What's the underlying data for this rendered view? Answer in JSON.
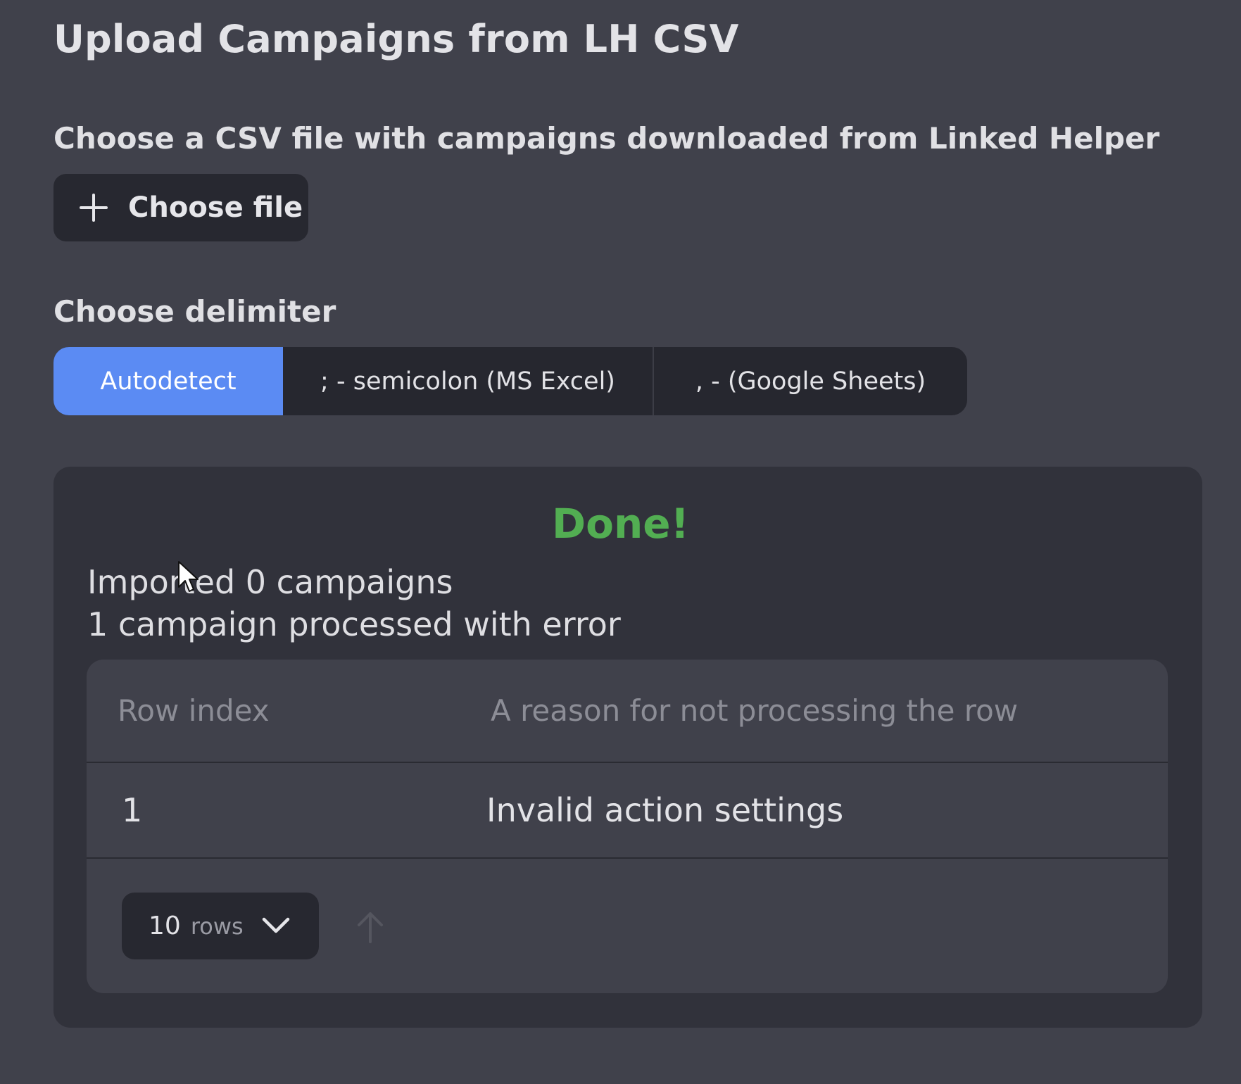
{
  "page": {
    "title": "Upload Campaigns from LH CSV"
  },
  "file_section": {
    "label": "Choose a CSV file with campaigns downloaded from Linked Helper",
    "button_label": "Choose file",
    "button_icon": "plus-icon"
  },
  "delimiter_section": {
    "label": "Choose delimiter",
    "options": [
      {
        "label": "Autodetect",
        "selected": true
      },
      {
        "label": "; - semicolon (MS Excel)",
        "selected": false
      },
      {
        "label": ", - (Google Sheets)",
        "selected": false
      }
    ]
  },
  "result": {
    "status": "Done!",
    "imported_text": "Imported 0 campaigns",
    "error_text": "1 campaign processed with error",
    "table": {
      "columns": [
        "Row index",
        "A reason for not processing the row"
      ],
      "rows": [
        [
          "1",
          "Invalid action settings"
        ]
      ]
    },
    "pagination": {
      "rows_count": "10",
      "rows_unit": "rows",
      "dropdown_icon": "chevron-down-icon",
      "sort_icon": "arrow-up-icon"
    }
  },
  "colors": {
    "background": "#40414b",
    "panel": "#31323b",
    "accent": "#5b8bf3",
    "success": "#52ae52",
    "button": "#272830"
  }
}
